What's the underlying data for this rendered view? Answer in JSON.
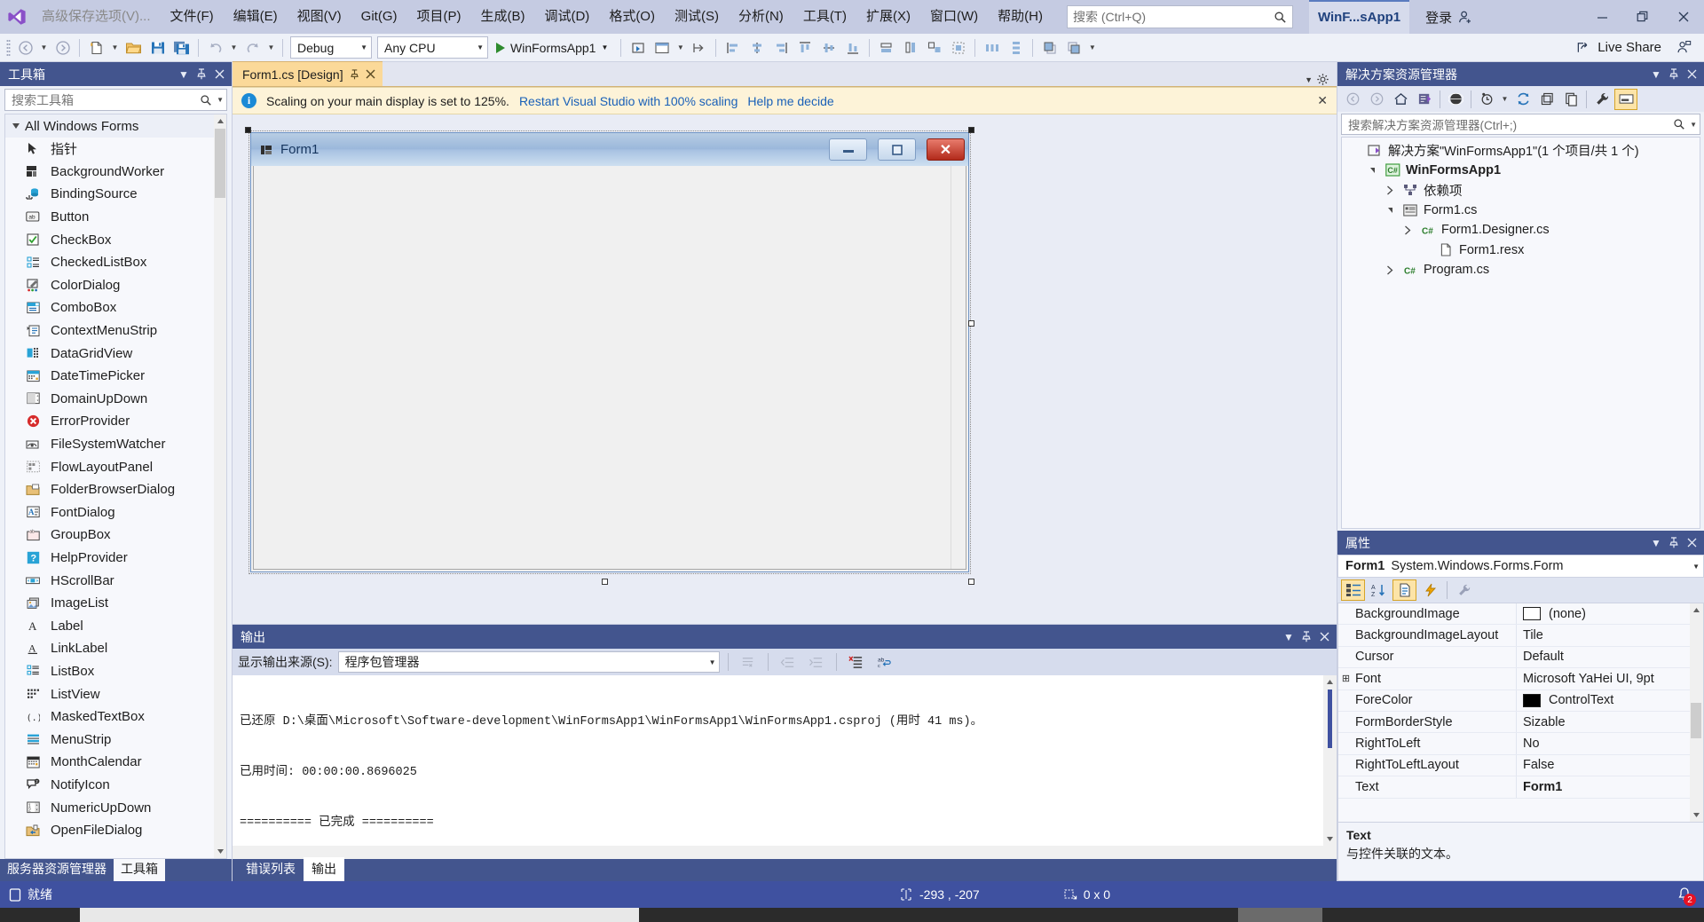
{
  "menubar": {
    "logo_icon": "visual-studio-logo",
    "advanced_save": "高级保存选项(V)...",
    "items": [
      {
        "label": "文件(F)",
        "mnemonic": "F"
      },
      {
        "label": "编辑(E)",
        "mnemonic": "E"
      },
      {
        "label": "视图(V)",
        "mnemonic": "V"
      },
      {
        "label": "Git(G)",
        "mnemonic": "G"
      },
      {
        "label": "项目(P)",
        "mnemonic": "P"
      },
      {
        "label": "生成(B)",
        "mnemonic": "B"
      },
      {
        "label": "调试(D)",
        "mnemonic": "D"
      },
      {
        "label": "格式(O)",
        "mnemonic": "O"
      },
      {
        "label": "测试(S)",
        "mnemonic": "S"
      },
      {
        "label": "分析(N)",
        "mnemonic": "N"
      },
      {
        "label": "工具(T)",
        "mnemonic": "T"
      },
      {
        "label": "扩展(X)",
        "mnemonic": "X"
      },
      {
        "label": "窗口(W)",
        "mnemonic": "W"
      },
      {
        "label": "帮助(H)",
        "mnemonic": "H"
      }
    ],
    "search_placeholder": "搜索 (Ctrl+Q)",
    "search_icon": "search-icon",
    "project_chip": "WinF...sApp1",
    "signin_label": "登录",
    "signin_icon": "account-add-icon",
    "window_minimize": "—",
    "window_restore": "❐",
    "window_close": "✕"
  },
  "toolbar": {
    "nav_back_icon": "navigate-back-icon",
    "nav_forward_icon": "navigate-forward-icon",
    "new_project_icon": "new-project-icon",
    "open_project_icon": "open-folder-icon",
    "save_icon": "save-icon",
    "save_all_icon": "save-all-icon",
    "undo_icon": "undo-icon",
    "redo_icon": "redo-icon",
    "config_value": "Debug",
    "platform_value": "Any CPU",
    "run_label": "WinFormsApp1",
    "run_icon": "play-icon",
    "live_share_label": "Live Share",
    "live_share_icon": "live-share-icon",
    "designer_icons": [
      "select-tool-icon",
      "preview-icon",
      "tab-order-icon",
      "align-lefts-icon",
      "align-centers-icon",
      "align-rights-icon",
      "align-tops-icon",
      "align-middles-icon",
      "align-bottoms-icon",
      "make-same-width-icon",
      "make-same-height-icon",
      "make-same-size-icon",
      "make-horizontal-spacing-equal-icon",
      "make-vertical-spacing-equal-icon",
      "bring-to-front-icon",
      "send-to-back-icon",
      "overflow-icon"
    ]
  },
  "toolbox": {
    "title": "工具箱",
    "search_placeholder": "搜索工具箱",
    "search_icon": "search-icon",
    "dropdown_icon": "chevron-down-icon",
    "pin_icon": "pin-icon",
    "close_icon": "close-icon",
    "group_label": "All Windows Forms",
    "items": [
      {
        "label": "指针",
        "icon": "pointer-icon"
      },
      {
        "label": "BackgroundWorker",
        "icon": "background-worker-icon"
      },
      {
        "label": "BindingSource",
        "icon": "binding-source-icon"
      },
      {
        "label": "Button",
        "icon": "button-icon"
      },
      {
        "label": "CheckBox",
        "icon": "checkbox-icon"
      },
      {
        "label": "CheckedListBox",
        "icon": "checked-list-box-icon"
      },
      {
        "label": "ColorDialog",
        "icon": "color-dialog-icon"
      },
      {
        "label": "ComboBox",
        "icon": "combo-box-icon"
      },
      {
        "label": "ContextMenuStrip",
        "icon": "context-menu-strip-icon"
      },
      {
        "label": "DataGridView",
        "icon": "data-grid-view-icon"
      },
      {
        "label": "DateTimePicker",
        "icon": "date-time-picker-icon"
      },
      {
        "label": "DomainUpDown",
        "icon": "domain-up-down-icon"
      },
      {
        "label": "ErrorProvider",
        "icon": "error-provider-icon"
      },
      {
        "label": "FileSystemWatcher",
        "icon": "file-system-watcher-icon"
      },
      {
        "label": "FlowLayoutPanel",
        "icon": "flow-layout-panel-icon"
      },
      {
        "label": "FolderBrowserDialog",
        "icon": "folder-browser-dialog-icon"
      },
      {
        "label": "FontDialog",
        "icon": "font-dialog-icon"
      },
      {
        "label": "GroupBox",
        "icon": "group-box-icon"
      },
      {
        "label": "HelpProvider",
        "icon": "help-provider-icon"
      },
      {
        "label": "HScrollBar",
        "icon": "h-scroll-bar-icon"
      },
      {
        "label": "ImageList",
        "icon": "image-list-icon"
      },
      {
        "label": "Label",
        "icon": "label-icon"
      },
      {
        "label": "LinkLabel",
        "icon": "link-label-icon"
      },
      {
        "label": "ListBox",
        "icon": "list-box-icon"
      },
      {
        "label": "ListView",
        "icon": "list-view-icon"
      },
      {
        "label": "MaskedTextBox",
        "icon": "masked-text-box-icon"
      },
      {
        "label": "MenuStrip",
        "icon": "menu-strip-icon"
      },
      {
        "label": "MonthCalendar",
        "icon": "month-calendar-icon"
      },
      {
        "label": "NotifyIcon",
        "icon": "notify-icon-icon"
      },
      {
        "label": "NumericUpDown",
        "icon": "numeric-up-down-icon"
      },
      {
        "label": "OpenFileDialog",
        "icon": "open-file-dialog-icon"
      }
    ],
    "tabs": [
      {
        "label": "服务器资源管理器",
        "active": false
      },
      {
        "label": "工具箱",
        "active": true
      }
    ]
  },
  "editor": {
    "tab_label": "Form1.cs [Design]",
    "tab_pin_icon": "pin-icon",
    "tab_close_icon": "close-icon",
    "strip_dropdown_icon": "chevron-down-icon",
    "strip_settings_icon": "gear-icon",
    "infobar": {
      "icon": "info-icon",
      "message": "Scaling on your main display is set to 125%.",
      "link1": "Restart Visual Studio with 100% scaling",
      "link2": "Help me decide",
      "close": "✕"
    },
    "form": {
      "title": "Form1",
      "icon": "form-icon",
      "minimize": "—",
      "maximize": "❐",
      "close": "✕"
    }
  },
  "output": {
    "title": "输出",
    "dropdown_icon": "chevron-down-icon",
    "pin_icon": "pin-icon",
    "close_icon": "close-icon",
    "source_label": "显示输出来源(S):",
    "source_value": "程序包管理器",
    "buttons": [
      "go-to-message-icon",
      "previous-message-icon",
      "next-message-icon",
      "clear-all-icon",
      "toggle-word-wrap-icon"
    ],
    "lines": [
      "已还原 D:\\桌面\\Microsoft\\Software-development\\WinFormsApp1\\WinFormsApp1\\WinFormsApp1.csproj (用时 41 ms)。",
      "已用时间: 00:00:00.8696025",
      "========== 已完成 =========="
    ],
    "tabs": [
      {
        "label": "错误列表",
        "active": false
      },
      {
        "label": "输出",
        "active": true
      }
    ]
  },
  "solution_explorer": {
    "title": "解决方案资源管理器",
    "dropdown_icon": "chevron-down-icon",
    "pin_icon": "pin-icon",
    "close_icon": "close-icon",
    "toolbar_icons": [
      "back-icon",
      "forward-icon",
      "home-icon",
      "solution-explorer-icon",
      "all-files-icon",
      "pending-changes-icon",
      "refresh-icon",
      "collapse-all-icon",
      "show-all-files-icon",
      "properties-wrench-icon",
      "preview-selected-items-icon"
    ],
    "search_placeholder": "搜索解决方案资源管理器(Ctrl+;)",
    "search_icon": "search-icon",
    "tree": [
      {
        "label": "解决方案\"WinFormsApp1\"(1 个项目/共 1 个)",
        "indent": 0,
        "twisty": "none",
        "icon": "solution-icon",
        "bold": false
      },
      {
        "label": "WinFormsApp1",
        "indent": 1,
        "twisty": "expanded",
        "icon": "csharp-project-icon",
        "bold": true
      },
      {
        "label": "依赖项",
        "indent": 2,
        "twisty": "collapsed",
        "icon": "dependencies-icon",
        "bold": false
      },
      {
        "label": "Form1.cs",
        "indent": 2,
        "twisty": "expanded",
        "icon": "form-file-icon",
        "bold": false
      },
      {
        "label": "Form1.Designer.cs",
        "indent": 3,
        "twisty": "collapsed",
        "icon": "csharp-file-icon",
        "bold": false
      },
      {
        "label": "Form1.resx",
        "indent": 4,
        "twisty": "none",
        "icon": "resx-file-icon",
        "bold": false
      },
      {
        "label": "Program.cs",
        "indent": 2,
        "twisty": "collapsed",
        "icon": "csharp-file-icon",
        "bold": false
      }
    ]
  },
  "properties": {
    "title": "属性",
    "dropdown_icon": "chevron-down-icon",
    "pin_icon": "pin-icon",
    "close_icon": "close-icon",
    "object_name": "Form1",
    "object_type": "System.Windows.Forms.Form",
    "object_dropdown_icon": "chevron-down-icon",
    "toolbar_icons": [
      "categorized-icon",
      "alphabetical-icon",
      "properties-page-icon",
      "events-icon",
      "property-pages-icon"
    ],
    "rows": [
      {
        "name": "BackgroundImage",
        "value": "(none)",
        "expandable": false,
        "swatch": "#ffffff"
      },
      {
        "name": "BackgroundImageLayout",
        "value": "Tile",
        "expandable": false,
        "swatch": null
      },
      {
        "name": "Cursor",
        "value": "Default",
        "expandable": false,
        "swatch": null
      },
      {
        "name": "Font",
        "value": "Microsoft YaHei UI, 9pt",
        "expandable": true,
        "swatch": null
      },
      {
        "name": "ForeColor",
        "value": "ControlText",
        "expandable": false,
        "swatch": "#000000"
      },
      {
        "name": "FormBorderStyle",
        "value": "Sizable",
        "expandable": false,
        "swatch": null
      },
      {
        "name": "RightToLeft",
        "value": "No",
        "expandable": false,
        "swatch": null
      },
      {
        "name": "RightToLeftLayout",
        "value": "False",
        "expandable": false,
        "swatch": null
      },
      {
        "name": "Text",
        "value": "Form1",
        "expandable": false,
        "swatch": null,
        "bold_value": true
      }
    ],
    "desc_title": "Text",
    "desc_body": "与控件关联的文本。"
  },
  "statusbar": {
    "status_icon": "ready-icon",
    "status_text": "就绪",
    "position_icon": "cursor-position-icon",
    "position_text": "-293 , -207",
    "size_icon": "size-icon",
    "size_text": "0 x 0",
    "notification_icon": "bell-icon",
    "notification_count": "2"
  },
  "colors": {
    "menubar_bg": "#c5cbe2",
    "panel_header_bg": "#43558e",
    "statusbar_bg": "#3f51a0",
    "accent_link": "#1960b8",
    "infobar_bg": "#fdf3d8",
    "tab_active_bg": "#fbd999"
  }
}
